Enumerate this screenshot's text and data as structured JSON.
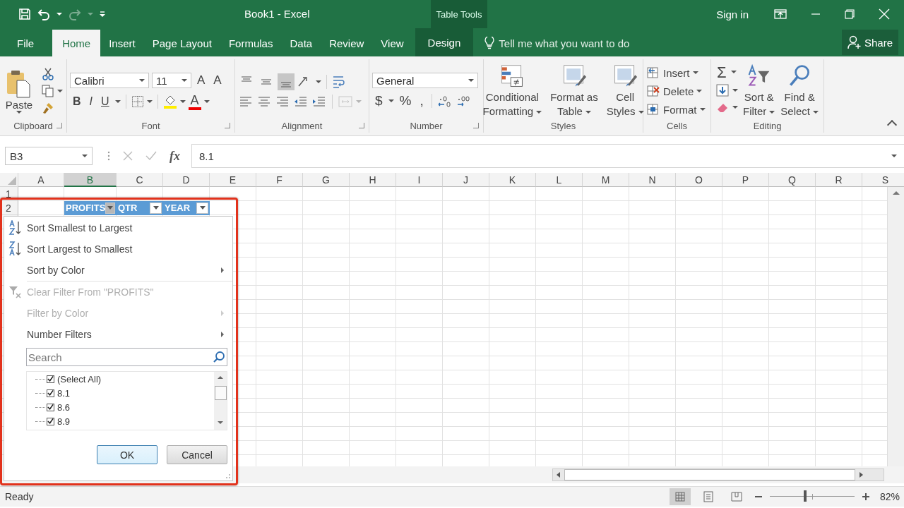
{
  "title_bar": {
    "title": "Book1 - Excel",
    "context_label": "Table Tools",
    "sign_in": "Sign in",
    "redo": {
      "disabled": true
    }
  },
  "tabs": [
    {
      "label": "File",
      "selected": false,
      "kind": "file"
    },
    {
      "label": "Home",
      "selected": true,
      "kind": "main"
    },
    {
      "label": "Insert",
      "selected": false,
      "kind": "main"
    },
    {
      "label": "Page Layout",
      "selected": false,
      "kind": "main"
    },
    {
      "label": "Formulas",
      "selected": false,
      "kind": "main"
    },
    {
      "label": "Data",
      "selected": false,
      "kind": "main"
    },
    {
      "label": "Review",
      "selected": false,
      "kind": "main"
    },
    {
      "label": "View",
      "selected": false,
      "kind": "main"
    },
    {
      "label": "Design",
      "selected": false,
      "kind": "contextual"
    }
  ],
  "tell_me": {
    "placeholder": "Tell me what you want to do"
  },
  "share": "Share",
  "ribbon": {
    "clipboard": {
      "label": "Clipboard",
      "paste": "Paste"
    },
    "font": {
      "label": "Font",
      "family": "Calibri",
      "size": "11",
      "grow": "A",
      "shrink": "A",
      "bold": "B",
      "italic": "I",
      "underline": "U",
      "font_color": "A"
    },
    "alignment": {
      "label": "Alignment",
      "vertical": [
        {
          "kind": "top",
          "selected": false
        },
        {
          "kind": "middle",
          "selected": false
        },
        {
          "kind": "bottom",
          "selected": true
        }
      ],
      "merge": {
        "disabled": true
      }
    },
    "number": {
      "label": "Number",
      "format": "General",
      "currency": "$",
      "percent": "%",
      "comma": ","
    },
    "styles": {
      "label": "Styles",
      "buttons": [
        "Conditional\nFormatting",
        "Format as\nTable",
        "Cell\nStyles"
      ]
    },
    "cells": {
      "label": "Cells",
      "buttons": [
        "Insert",
        "Delete",
        "Format"
      ]
    },
    "editing": {
      "label": "Editing",
      "sum": "Σ",
      "buttons": [
        "Sort &\nFilter",
        "Find &\nSelect"
      ]
    }
  },
  "formula_bar": {
    "name_box": "B3",
    "fx": "fx",
    "value": "8.1"
  },
  "sheet": {
    "columns": [
      {
        "label": "A",
        "selected": false
      },
      {
        "label": "B",
        "selected": true
      },
      {
        "label": "C",
        "selected": false
      },
      {
        "label": "D",
        "selected": false
      },
      {
        "label": "E",
        "selected": false
      },
      {
        "label": "F",
        "selected": false
      },
      {
        "label": "G",
        "selected": false
      },
      {
        "label": "H",
        "selected": false
      },
      {
        "label": "I",
        "selected": false
      },
      {
        "label": "J",
        "selected": false
      },
      {
        "label": "K",
        "selected": false
      },
      {
        "label": "L",
        "selected": false
      },
      {
        "label": "M",
        "selected": false
      },
      {
        "label": "N",
        "selected": false
      },
      {
        "label": "O",
        "selected": false
      },
      {
        "label": "P",
        "selected": false
      },
      {
        "label": "Q",
        "selected": false
      },
      {
        "label": "R",
        "selected": false
      },
      {
        "label": "S",
        "selected": false
      }
    ],
    "rows": [
      "1",
      "2"
    ],
    "table_headers": [
      {
        "label": "PROFITS",
        "filter_open": true
      },
      {
        "label": "QTR",
        "filter_open": false
      },
      {
        "label": "YEAR",
        "filter_open": false
      }
    ]
  },
  "filter_menu": {
    "items": [
      {
        "kind": "sort_asc",
        "label": "Sort Smallest to Largest",
        "disabled": false
      },
      {
        "kind": "sort_desc",
        "label": "Sort Largest to Smallest",
        "disabled": false
      },
      {
        "kind": "submenu",
        "label": "Sort by Color",
        "disabled": false
      },
      {
        "kind": "separator"
      },
      {
        "kind": "clear",
        "label": "Clear Filter From \"PROFITS\"",
        "disabled": true
      },
      {
        "kind": "submenu",
        "label": "Filter by Color",
        "disabled": true
      },
      {
        "kind": "submenu",
        "label": "Number Filters",
        "disabled": false
      }
    ],
    "search": {
      "placeholder": "Search"
    },
    "values": [
      {
        "label": "(Select All)",
        "checked": true
      },
      {
        "label": "8.1",
        "checked": true
      },
      {
        "label": "8.6",
        "checked": true
      },
      {
        "label": "8.9",
        "checked": true
      }
    ],
    "ok": "OK",
    "cancel": "Cancel"
  },
  "status_bar": {
    "status": "Ready",
    "views": [
      {
        "kind": "normal",
        "selected": true
      },
      {
        "kind": "page_layout",
        "selected": false
      },
      {
        "kind": "page_break",
        "selected": false
      }
    ],
    "zoom": {
      "level": 0.42,
      "reading": "82%"
    }
  }
}
